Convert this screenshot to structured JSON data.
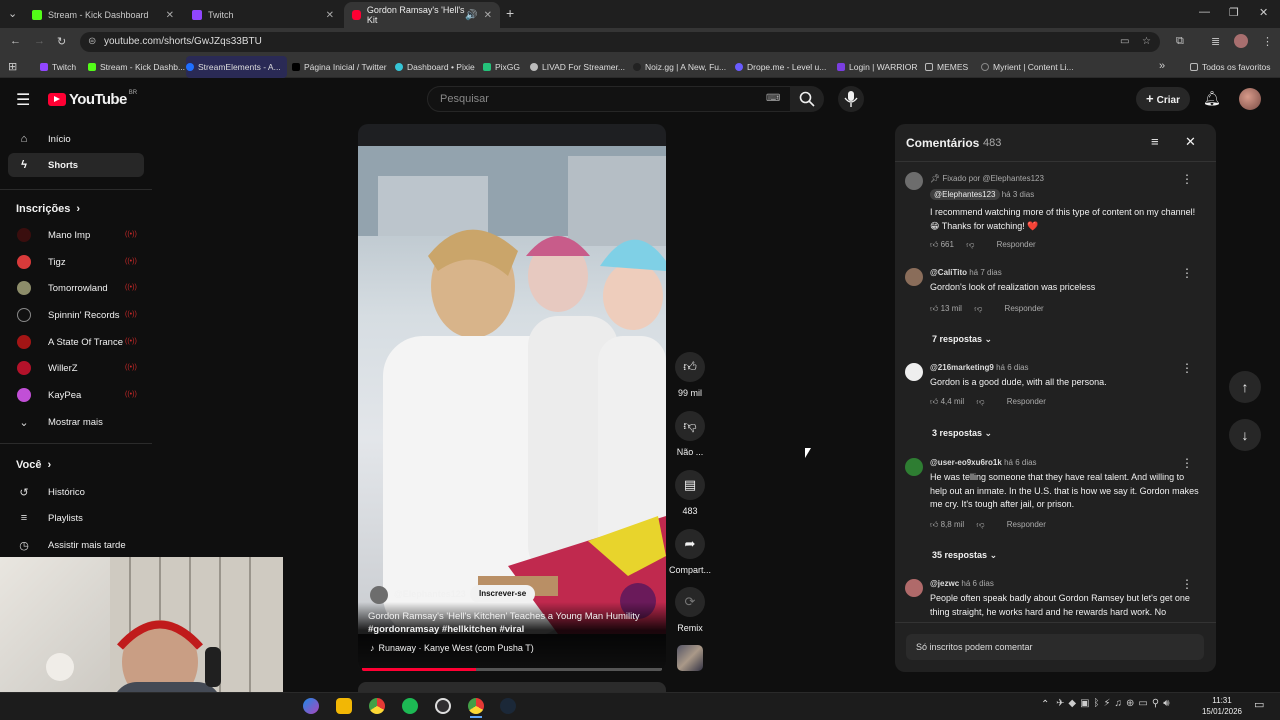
{
  "browser": {
    "tabs": [
      {
        "title": "Stream - Kick Dashboard",
        "color": "#53fc18"
      },
      {
        "title": "Twitch",
        "color": "#9146ff"
      },
      {
        "title": "Gordon Ramsay's 'Hell's Kit",
        "color": "#ff0033"
      }
    ],
    "url": "youtube.com/shorts/GwJZqs33BTU",
    "bookmarks": [
      {
        "label": "Twitch",
        "color": "#9146ff"
      },
      {
        "label": "Stream - Kick Dashb...",
        "color": "#53fc18"
      },
      {
        "label": "StreamElements - A...",
        "color": "#1f6fff"
      },
      {
        "label": "Página Inicial / Twitter",
        "color": "#000000"
      },
      {
        "label": "Dashboard • Pixie",
        "color": "#36c5d6"
      },
      {
        "label": "PixGG",
        "color": "#24c27a"
      },
      {
        "label": "LIVAD For Streamer...",
        "color": "#bbbbbb"
      },
      {
        "label": "Noiz.gg | A New, Fu...",
        "color": "#222222"
      },
      {
        "label": "Drope.me - Level u...",
        "color": "#6a5cff"
      },
      {
        "label": "Login | WARRIOR",
        "color": "#7a3ee0"
      },
      {
        "label": "MEMES",
        "color": "#bbbbbb"
      },
      {
        "label": "Myrient | Content Li...",
        "color": "#bbbbbb"
      }
    ],
    "all_favorites": "Todos os favoritos"
  },
  "youtube": {
    "logo": "YouTube",
    "country": "BR",
    "search_placeholder": "Pesquisar",
    "create_label": "Criar"
  },
  "sidebar": {
    "main": [
      {
        "label": "Início",
        "icon": "home-icon"
      },
      {
        "label": "Shorts",
        "icon": "shorts-icon"
      }
    ],
    "subscriptions_title": "Inscrições",
    "subscriptions": [
      {
        "label": "Mano Imp",
        "color": "#3a0e0e"
      },
      {
        "label": "Tigz",
        "color": "#d83a3a"
      },
      {
        "label": "Tomorrowland",
        "color": "#8d8d6a"
      },
      {
        "label": "Spinnin' Records",
        "color": "#111111"
      },
      {
        "label": "A State Of Trance",
        "color": "#a31515"
      },
      {
        "label": "WillerZ",
        "color": "#b3122a"
      },
      {
        "label": "KayPea",
        "color": "#c14fd6"
      }
    ],
    "show_more": "Mostrar mais",
    "you_title": "Você",
    "you": [
      {
        "label": "Histórico",
        "icon": "history-icon"
      },
      {
        "label": "Playlists",
        "icon": "playlists-icon"
      },
      {
        "label": "Assistir mais tarde",
        "icon": "watch-later-icon"
      }
    ]
  },
  "short": {
    "channel": "@Elephantes123",
    "subscribe": "Inscrever-se",
    "title": "Gordon Ramsay's 'Hell's Kitchen' Teaches a Young Man Humility",
    "hashtags": "#gordonramsay #hellkitchen #viral",
    "music": "Runaway · Kanye West (com Pusha T)",
    "likes": "99 mil",
    "dislike": "Não ...",
    "comments": "483",
    "share": "Compart...",
    "remix": "Remix",
    "progress": 0.38
  },
  "comments": {
    "title": "Comentários",
    "count": "483",
    "items": [
      {
        "pinned": "Fixado por @Elephantes123",
        "author": "@Elephantes123",
        "time": "há 3 dias",
        "text": "I recommend watching more of this type of content on my channel! 😁 Thanks for watching! ❤️",
        "likes": "661",
        "reply": "Responder",
        "avatar_color": "#6d6d6d"
      },
      {
        "author": "@CaliTito",
        "time": "há 7 dias",
        "text": "Gordon's look of realization was priceless",
        "likes": "13 mil",
        "reply": "Responder",
        "replies": "7 respostas",
        "avatar_color": "#8a6d5a"
      },
      {
        "author": "@216marketing9",
        "time": "há 6 dias",
        "text": "Gordon is a good dude, with all the persona.",
        "likes": "4,4 mil",
        "reply": "Responder",
        "replies": "3 respostas",
        "avatar_color": "#eeeeee"
      },
      {
        "author": "@user-eo9xu6ro1k",
        "time": "há 6 dias",
        "text": "He was telling someone that they have real talent. And willing to help out an inmate.  In the U.S. that is how we say it.  Gordon makes me cry.  It's tough after jail, or prison.",
        "likes": "8,8 mil",
        "reply": "Responder",
        "replies": "35 respostas",
        "avatar_color": "#2e7d32"
      },
      {
        "author": "@jezwc",
        "time": "há 6 dias",
        "text": "People often speak badly about Gordon Ramsey but let's get one thing straight, he works hard and he rewards hard work. No",
        "avatar_color": "#b06a6a"
      }
    ],
    "only_subscribers": "Só inscritos podem comentar"
  },
  "taskbar": {
    "time": "11:31",
    "date": "15/01/2026"
  }
}
